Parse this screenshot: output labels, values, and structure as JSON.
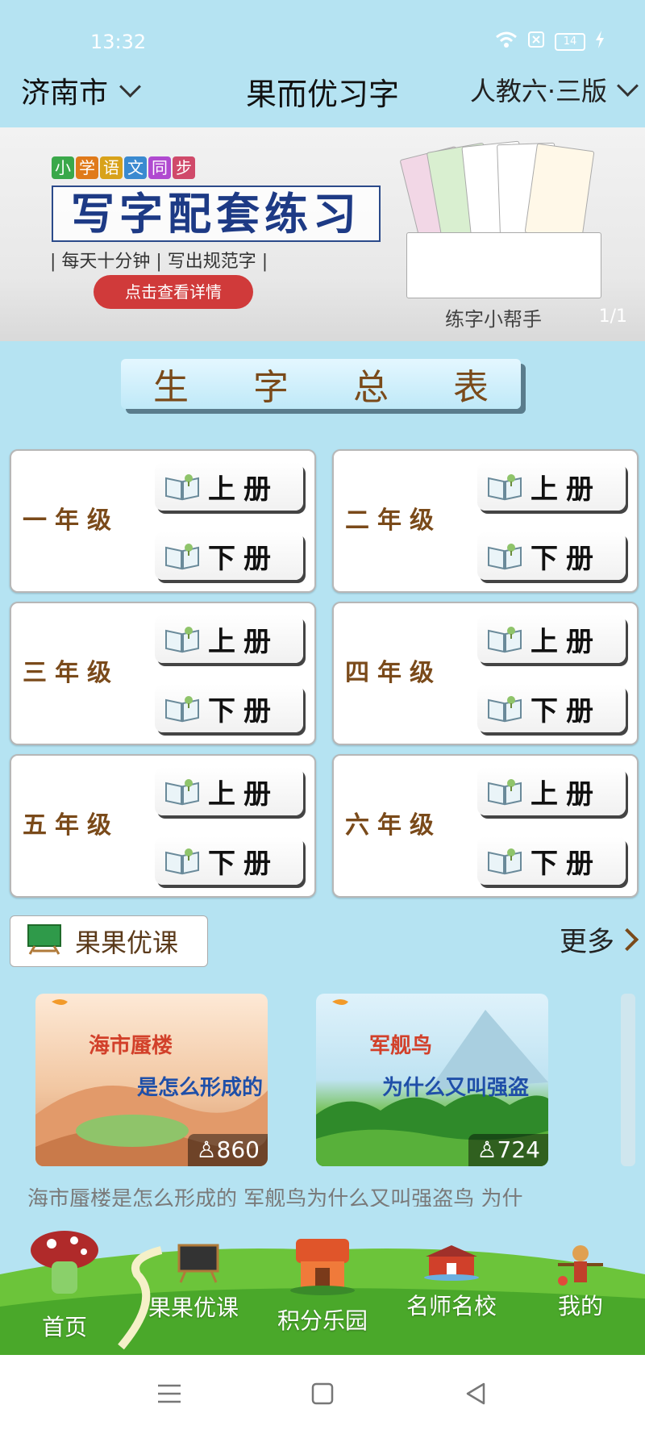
{
  "status_bar": {
    "time": "13:32",
    "battery": "14"
  },
  "header": {
    "city": "济南市",
    "app_title": "果而优习字",
    "edition": "人教六·三版"
  },
  "banner": {
    "small_title_chars": [
      "小",
      "学",
      "语",
      "文",
      "同",
      "步"
    ],
    "title": "写字配套练习",
    "subtitle": "| 每天十分钟 | 写出规范字 |",
    "detail_button": "点击查看详情",
    "caption": "练字小帮手",
    "page_indicator": "1/1"
  },
  "section": {
    "title_chars": [
      "生",
      "字",
      "总",
      "表"
    ]
  },
  "grades": [
    {
      "name": "一年级",
      "vol_top": "上册",
      "vol_bottom": "下册"
    },
    {
      "name": "二年级",
      "vol_top": "上册",
      "vol_bottom": "下册"
    },
    {
      "name": "三年级",
      "vol_top": "上册",
      "vol_bottom": "下册"
    },
    {
      "name": "四年级",
      "vol_top": "上册",
      "vol_bottom": "下册"
    },
    {
      "name": "五年级",
      "vol_top": "上册",
      "vol_bottom": "下册"
    },
    {
      "name": "六年级",
      "vol_top": "上册",
      "vol_bottom": "下册"
    }
  ],
  "courses": {
    "tag": "果果优课",
    "more": "更多",
    "items": [
      {
        "title_a": "海市蜃楼",
        "title_b": "是怎么形成的",
        "views": "860"
      },
      {
        "title_a": "军舰鸟",
        "title_b": "为什么又叫强盗",
        "views": "724"
      }
    ],
    "caption": "海市蜃楼是怎么形成的  军舰鸟为什么又叫强盗鸟  为什"
  },
  "bottom_nav": [
    {
      "label": "首页"
    },
    {
      "label": "果果优课"
    },
    {
      "label": "积分乐园"
    },
    {
      "label": "名师名校"
    },
    {
      "label": "我的"
    }
  ],
  "colors": {
    "background": "#b5e3f2",
    "grade_text": "#7a4a1a",
    "detail_button": "#d03a3a"
  }
}
